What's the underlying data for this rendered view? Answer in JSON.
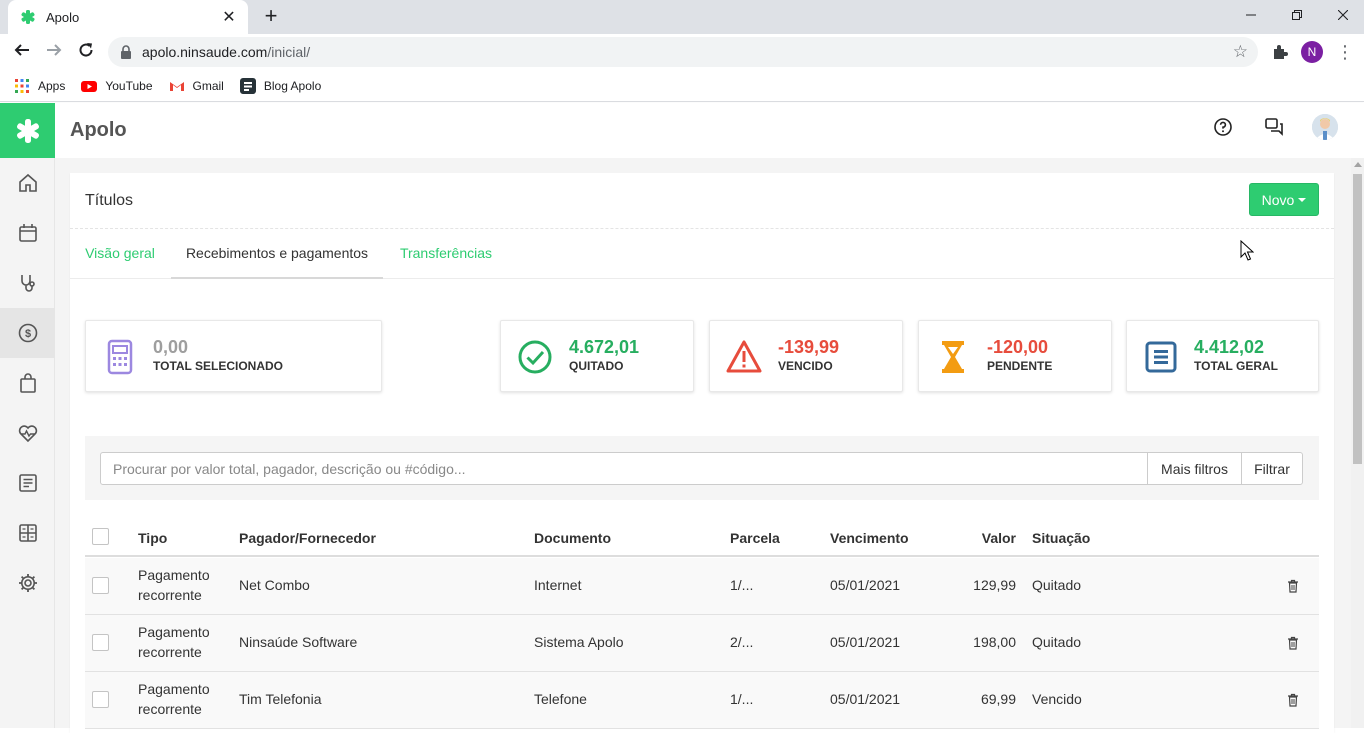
{
  "browser": {
    "tab_title": "Apolo",
    "tab_close": "✕",
    "new_tab": "+",
    "url_host": "apolo.ninsaude.com",
    "url_path": "/inicial/",
    "profile_initial": "N",
    "bookmarks": [
      {
        "label": "Apps",
        "icon": "apps-grid-icon"
      },
      {
        "label": "YouTube",
        "icon": "youtube-icon"
      },
      {
        "label": "Gmail",
        "icon": "gmail-icon"
      },
      {
        "label": "Blog Apolo",
        "icon": "blog-icon"
      }
    ]
  },
  "app": {
    "name": "Apolo",
    "brand_color": "#2ecc71"
  },
  "page": {
    "title": "Títulos",
    "new_button": "Novo",
    "tabs": [
      {
        "label": "Visão geral",
        "active": false
      },
      {
        "label": "Recebimentos e pagamentos",
        "active": true
      },
      {
        "label": "Transferências",
        "active": false
      }
    ]
  },
  "stats": {
    "selected": {
      "value": "0,00",
      "label": "TOTAL SELECIONADO",
      "color": "#9e9e9e",
      "icon": "calculator-icon"
    },
    "paid": {
      "value": "4.672,01",
      "label": "QUITADO",
      "color": "#27ae60",
      "icon": "check-circle-icon"
    },
    "overdue": {
      "value": "-139,99",
      "label": "VENCIDO",
      "color": "#e74c3c",
      "icon": "warning-icon"
    },
    "pending": {
      "value": "-120,00",
      "label": "PENDENTE",
      "color": "#e74c3c",
      "icon": "hourglass-icon"
    },
    "total": {
      "value": "4.412,02",
      "label": "TOTAL GERAL",
      "color": "#27ae60",
      "icon": "document-icon"
    }
  },
  "filters": {
    "search_placeholder": "Procurar por valor total, pagador, descrição ou #código...",
    "more_filters": "Mais filtros",
    "filter": "Filtrar"
  },
  "table": {
    "headers": {
      "type": "Tipo",
      "payer": "Pagador/Fornecedor",
      "document": "Documento",
      "installment": "Parcela",
      "due": "Vencimento",
      "value": "Valor",
      "status": "Situação"
    },
    "rows": [
      {
        "type_line1": "Pagamento",
        "type_line2": "recorrente",
        "payer": "Net Combo",
        "document": "Internet",
        "installment": "1/...",
        "due": "05/01/2021",
        "value": "129,99",
        "status": "Quitado"
      },
      {
        "type_line1": "Pagamento",
        "type_line2": "recorrente",
        "payer": "Ninsaúde Software",
        "document": "Sistema Apolo",
        "installment": "2/...",
        "due": "05/01/2021",
        "value": "198,00",
        "status": "Quitado"
      },
      {
        "type_line1": "Pagamento",
        "type_line2": "recorrente",
        "payer": "Tim Telefonia",
        "document": "Telefone",
        "installment": "1/...",
        "due": "05/01/2021",
        "value": "69,99",
        "status": "Vencido"
      }
    ]
  }
}
